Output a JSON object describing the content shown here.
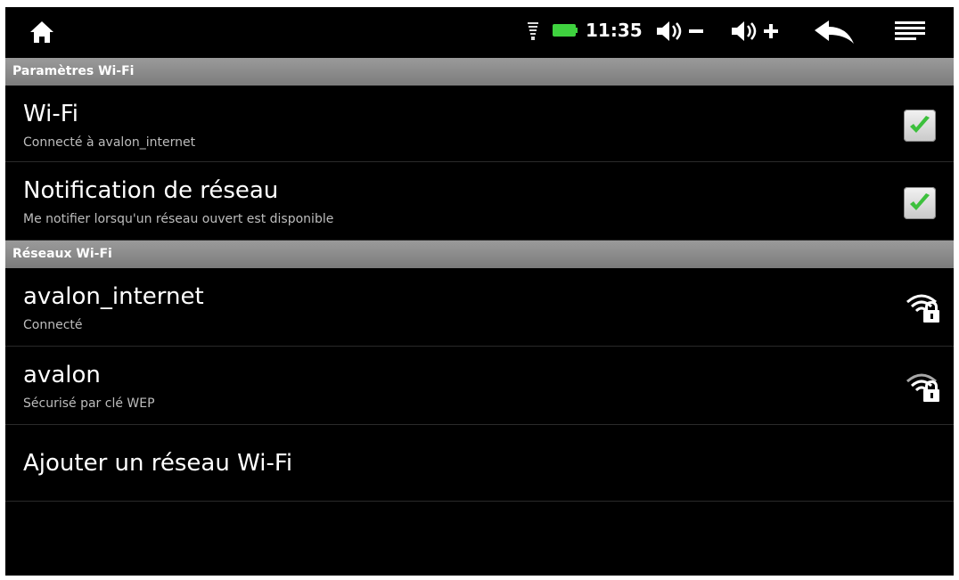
{
  "statusbar": {
    "time": "11:35",
    "icons": [
      "home-icon",
      "wifi-signal-icon",
      "battery-icon",
      "volume-down-icon",
      "volume-up-icon",
      "back-icon",
      "menu-icon"
    ],
    "battery_color": "#3fd23f"
  },
  "sections": {
    "wifi_settings": "Paramètres Wi-Fi",
    "wifi_networks": "Réseaux Wi-Fi"
  },
  "settings": {
    "wifi": {
      "title": "Wi-Fi",
      "summary": "Connecté à avalon_internet",
      "checked": true
    },
    "notification": {
      "title": "Notification de réseau",
      "summary": "Me notifier lorsqu'un réseau ouvert est disponible",
      "checked": true
    }
  },
  "networks": [
    {
      "name": "avalon_internet",
      "status": "Connecté",
      "icon": "wifi-lock-icon"
    },
    {
      "name": "avalon",
      "status": "Sécurisé par clé WEP",
      "icon": "wifi-lock-icon"
    }
  ],
  "add_network": {
    "label": "Ajouter un réseau Wi-Fi"
  },
  "colors": {
    "background": "#000000",
    "section_header": "#8a8a8a",
    "check": "#3cc03c"
  }
}
